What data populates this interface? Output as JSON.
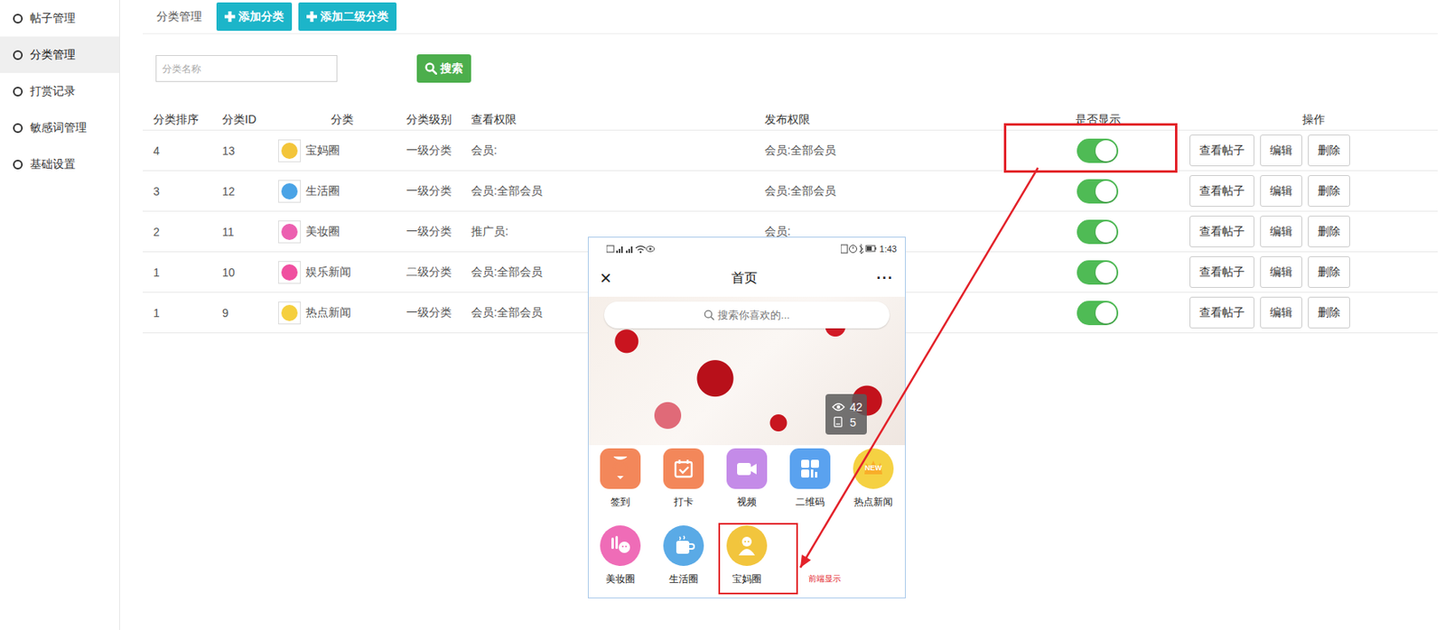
{
  "sidebar": {
    "items": [
      {
        "label": "帖子管理",
        "selected": false
      },
      {
        "label": "分类管理",
        "selected": true
      },
      {
        "label": "打赏记录",
        "selected": false
      },
      {
        "label": "敏感词管理",
        "selected": false
      },
      {
        "label": "基础设置",
        "selected": false
      }
    ]
  },
  "toolbar": {
    "title": "分类管理",
    "buttons": [
      "添加分类",
      "添加二级分类"
    ]
  },
  "search": {
    "placeholder": "分类名称",
    "button": "搜索"
  },
  "table": {
    "columns": [
      "分类排序",
      "分类ID",
      "分类",
      "分类级别",
      "查看权限",
      "发布权限",
      "是否显示",
      "操作"
    ],
    "rows": [
      {
        "sort": "4",
        "id": "13",
        "name": "宝妈圈",
        "color": "#f3c53a",
        "level": "一级分类",
        "view": "会员:",
        "publish": "会员:全部会员",
        "shown": true,
        "actions": [
          "查看帖子",
          "编辑",
          "删除"
        ]
      },
      {
        "sort": "3",
        "id": "12",
        "name": "生活圈",
        "color": "#4aa3e6",
        "level": "一级分类",
        "view": "会员:全部会员",
        "publish": "会员:全部会员",
        "shown": true,
        "actions": [
          "查看帖子",
          "编辑",
          "删除"
        ]
      },
      {
        "sort": "2",
        "id": "11",
        "name": "美妆圈",
        "color": "#ec5fb0",
        "level": "一级分类",
        "view": "推广员:",
        "publish": "会员:",
        "shown": true,
        "actions": [
          "查看帖子",
          "编辑",
          "删除"
        ]
      },
      {
        "sort": "1",
        "id": "10",
        "name": "娱乐新闻",
        "color": "#f04fa0",
        "level": "二级分类",
        "view": "会员:全部会员",
        "shown": true,
        "actions": [
          "查看帖子",
          "编辑",
          "删除"
        ]
      },
      {
        "sort": "1",
        "id": "9",
        "name": "热点新闻",
        "color": "#f5cf3e",
        "level": "一级分类",
        "view": "会员:全部会员",
        "shown": true,
        "actions": [
          "查看帖子",
          "编辑",
          "删除"
        ]
      }
    ]
  },
  "phone": {
    "time": "1:43",
    "close": "×",
    "title": "首页",
    "more": "···",
    "search_placeholder": "搜索你喜欢的...",
    "stats": {
      "views": "42",
      "count": "5"
    },
    "grid": [
      {
        "label": "签到",
        "kind": "square",
        "color": "#f3875a"
      },
      {
        "label": "打卡",
        "kind": "square",
        "color": "#f3875a"
      },
      {
        "label": "视频",
        "kind": "square",
        "color": "#c48be8"
      },
      {
        "label": "二维码",
        "kind": "square",
        "color": "#5aa2ef"
      },
      {
        "label": "热点新闻",
        "kind": "circle",
        "color": "#f5d142",
        "badge": "NEW"
      },
      {
        "label": "美妆圈",
        "kind": "circle",
        "color": "#ef6cb7"
      },
      {
        "label": "生活圈",
        "kind": "circle",
        "color": "#5aaae6"
      },
      {
        "label": "宝妈圈",
        "kind": "circle",
        "color": "#f2c53d"
      }
    ]
  },
  "annotation": {
    "label": "前端显示"
  }
}
